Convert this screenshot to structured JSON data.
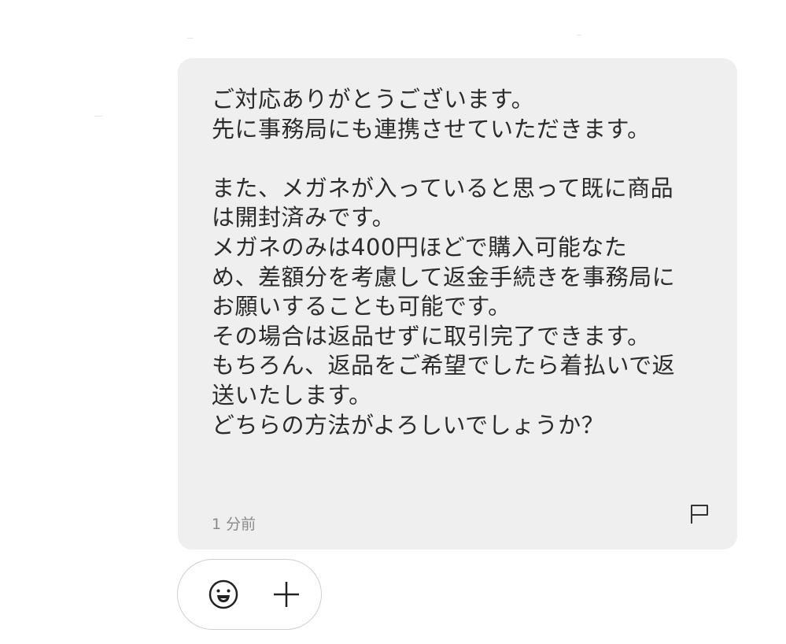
{
  "message": {
    "lines": [
      "ご対応ありがとうございます。",
      "先に事務局にも連携させていただきます。",
      "",
      "また、メガネが入っていると思って既に商品",
      "は開封済みです。",
      "メガネのみは400円ほどで購入可能なた",
      "め、差額分を考慮して返金手続きを事務局に",
      "お願いすることも可能です。",
      "その場合は返品せずに取引完了できます。",
      "もちろん、返品をご希望でしたら着払いで返",
      "送いたします。",
      "どちらの方法がよろしいでしょうか？"
    ],
    "timestamp": "1 分前"
  },
  "icons": {
    "flag": "flag-icon",
    "emoji": "smiley-face-icon",
    "plus": "plus-icon"
  },
  "colors": {
    "bubble_bg": "#efefef",
    "text": "#2b2b2b",
    "timestamp": "#8a8a8a"
  }
}
